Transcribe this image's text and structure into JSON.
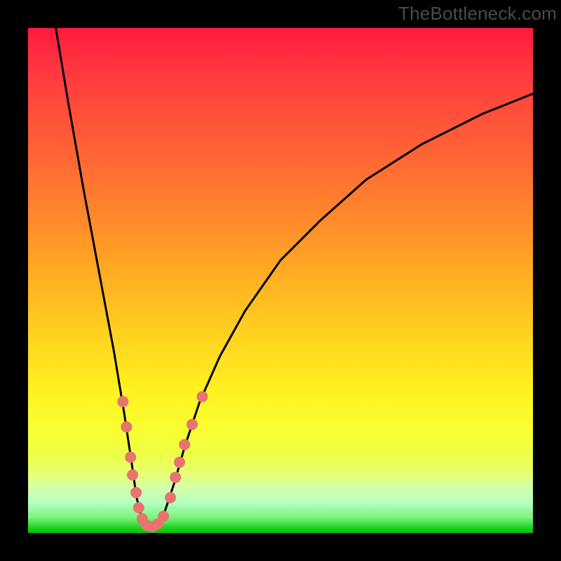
{
  "watermark": "TheBottleneck.com",
  "chart_data": {
    "type": "line",
    "title": "",
    "xlabel": "",
    "ylabel": "",
    "xlim": [
      0,
      100
    ],
    "ylim": [
      0,
      100
    ],
    "curve": {
      "description": "V-shaped bottleneck curve with minimum around x≈24",
      "points": [
        {
          "x": 5,
          "y": 103
        },
        {
          "x": 8,
          "y": 85
        },
        {
          "x": 11,
          "y": 68
        },
        {
          "x": 14,
          "y": 52
        },
        {
          "x": 17,
          "y": 36
        },
        {
          "x": 19,
          "y": 24
        },
        {
          "x": 20.5,
          "y": 14
        },
        {
          "x": 21.5,
          "y": 7
        },
        {
          "x": 22.5,
          "y": 3
        },
        {
          "x": 24,
          "y": 1
        },
        {
          "x": 25.5,
          "y": 2
        },
        {
          "x": 27,
          "y": 4
        },
        {
          "x": 29,
          "y": 10
        },
        {
          "x": 31,
          "y": 17
        },
        {
          "x": 34,
          "y": 26
        },
        {
          "x": 38,
          "y": 35
        },
        {
          "x": 43,
          "y": 44
        },
        {
          "x": 50,
          "y": 54
        },
        {
          "x": 58,
          "y": 62
        },
        {
          "x": 67,
          "y": 70
        },
        {
          "x": 78,
          "y": 77
        },
        {
          "x": 90,
          "y": 83
        },
        {
          "x": 100,
          "y": 87
        }
      ]
    },
    "dots": {
      "description": "Scatter markers clustered along V near bottom",
      "color": "#e8736f",
      "radius": 8,
      "points": [
        {
          "x": 18.8,
          "y": 26
        },
        {
          "x": 19.5,
          "y": 21
        },
        {
          "x": 20.3,
          "y": 15
        },
        {
          "x": 20.7,
          "y": 11.5
        },
        {
          "x": 21.4,
          "y": 8
        },
        {
          "x": 21.9,
          "y": 5
        },
        {
          "x": 22.6,
          "y": 2.8
        },
        {
          "x": 23.5,
          "y": 1.5
        },
        {
          "x": 24.6,
          "y": 1.2
        },
        {
          "x": 25.7,
          "y": 1.8
        },
        {
          "x": 26.8,
          "y": 3.3
        },
        {
          "x": 28.2,
          "y": 7
        },
        {
          "x": 29.2,
          "y": 11
        },
        {
          "x": 30,
          "y": 14
        },
        {
          "x": 31,
          "y": 17.5
        },
        {
          "x": 32.5,
          "y": 21.5
        },
        {
          "x": 34.5,
          "y": 27
        }
      ]
    }
  }
}
